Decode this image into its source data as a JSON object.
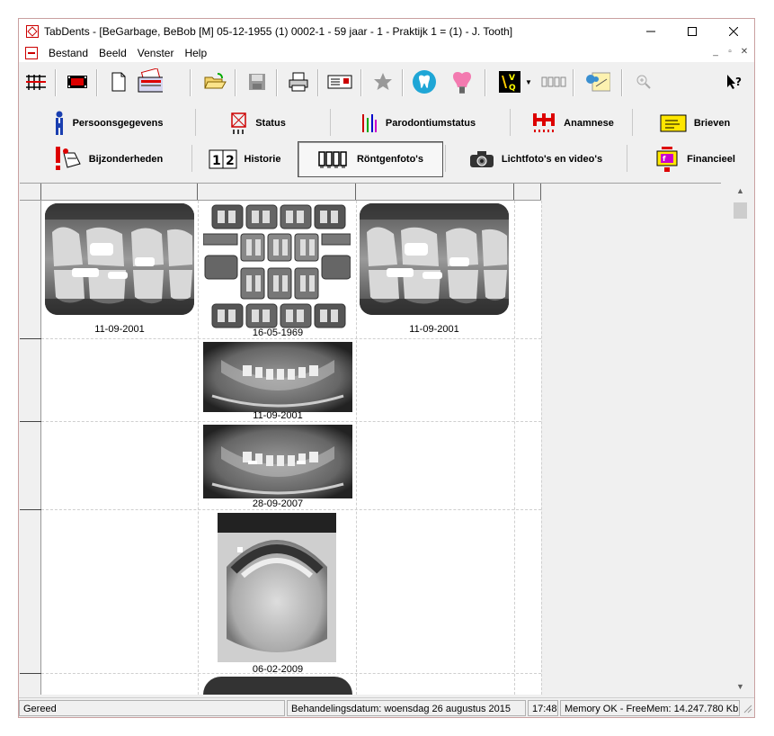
{
  "window": {
    "title": "TabDents - [BeGarbage, BeBob [M] 05-12-1955 (1) 0002-1 - 59 jaar - 1 - Praktijk 1 = (1) - J. Tooth]",
    "controls": [
      "minimize-icon",
      "maximize-icon",
      "close-icon"
    ]
  },
  "menubar": {
    "items": [
      "Bestand",
      "Beeld",
      "Venster",
      "Help"
    ]
  },
  "toolbar": {
    "icons": [
      "grid-icon",
      "film-icon",
      "new-document-icon",
      "patient-card-icon",
      "open-folder-icon",
      "save-icon",
      "print-icon",
      "letter-icon",
      "star-icon",
      "tooth-icon",
      "implant-icon",
      "vq-icon",
      "xray-strip-icon",
      "chart-icon",
      "zoom-icon",
      "help-pointer-icon"
    ]
  },
  "tabs": {
    "row1": [
      {
        "label": "Persoonsgegevens",
        "icon": "person-icon"
      },
      {
        "label": "Status",
        "icon": "status-icon"
      },
      {
        "label": "Parodontiumstatus",
        "icon": "parodontium-icon"
      },
      {
        "label": "Anamnese",
        "icon": "anamnese-icon"
      },
      {
        "label": "Brieven",
        "icon": "letter-icon"
      }
    ],
    "row2": [
      {
        "label": "Bijzonderheden",
        "icon": "warning-icon"
      },
      {
        "label": "Historie",
        "icon": "history-icon"
      },
      {
        "label": "Röntgenfoto's",
        "icon": "xray-icon",
        "active": true
      },
      {
        "label": "Lichtfoto's en video's",
        "icon": "camera-icon"
      },
      {
        "label": "Financieel",
        "icon": "finance-icon"
      }
    ]
  },
  "xrays": [
    {
      "date": "11-09-2001",
      "kind": "bitewing"
    },
    {
      "date": "16-05-1969",
      "kind": "full-mouth-series"
    },
    {
      "date": "11-09-2001",
      "kind": "bitewing"
    },
    {
      "date": "11-09-2001",
      "kind": "panoramic"
    },
    {
      "date": "28-09-2007",
      "kind": "panoramic"
    },
    {
      "date": "06-02-2009",
      "kind": "occlusal"
    }
  ],
  "statusbar": {
    "state": "Gereed",
    "treatment_date": "Behandelingsdatum: woensdag 26 augustus 2015",
    "time": "17:48",
    "memory": "Memory OK - FreeMem: 14.247.780 Kb"
  }
}
